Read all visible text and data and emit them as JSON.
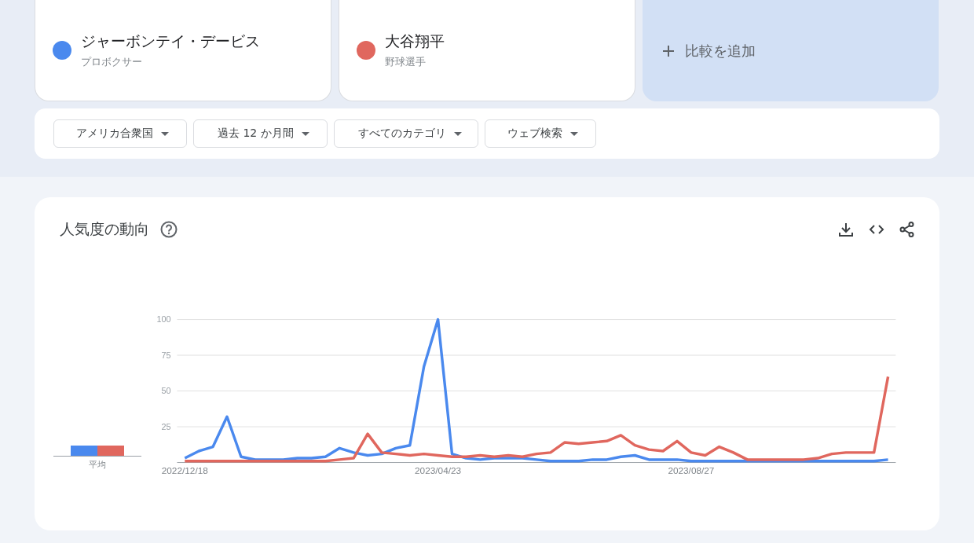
{
  "terms": [
    {
      "name": "ジャーボンテイ・デービス",
      "subtitle": "プロボクサー",
      "color": "#4a89ee"
    },
    {
      "name": "大谷翔平",
      "subtitle": "野球選手",
      "color": "#e0675e"
    }
  ],
  "add_compare": {
    "label": "比較を追加"
  },
  "filters": [
    "アメリカ合衆国",
    "過去 12 か月間",
    "すべてのカテゴリ",
    "ウェブ検索"
  ],
  "trend_card": {
    "title": "人気度の動向",
    "average_label": "平均",
    "chart_data": {
      "type": "line",
      "grid": true,
      "ylim": [
        0,
        100
      ],
      "yticks": [
        25,
        50,
        75,
        100
      ],
      "categories": [
        "2022/12/18",
        null,
        null,
        null,
        null,
        null,
        null,
        null,
        null,
        null,
        null,
        null,
        null,
        null,
        null,
        null,
        null,
        null,
        "2023/04/23",
        null,
        null,
        null,
        null,
        null,
        null,
        null,
        null,
        null,
        null,
        null,
        null,
        null,
        null,
        null,
        null,
        null,
        "2023/08/27",
        null,
        null,
        null,
        null,
        null,
        null,
        null,
        null,
        null,
        null,
        null,
        null,
        null,
        null
      ],
      "series": [
        {
          "color": "#4a89ee",
          "values": [
            3,
            8,
            11,
            32,
            4,
            2,
            2,
            2,
            3,
            3,
            4,
            10,
            7,
            5,
            6,
            10,
            12,
            67,
            100,
            6,
            3,
            2,
            3,
            3,
            3,
            2,
            1,
            1,
            1,
            2,
            2,
            4,
            5,
            2,
            2,
            2,
            1,
            1,
            1,
            1,
            1,
            1,
            1,
            1,
            1,
            1,
            1,
            1,
            1,
            1,
            2
          ]
        },
        {
          "color": "#e0675e",
          "values": [
            1,
            1,
            1,
            1,
            1,
            1,
            1,
            1,
            1,
            1,
            1,
            2,
            3,
            20,
            7,
            6,
            5,
            6,
            5,
            4,
            4,
            5,
            4,
            5,
            4,
            6,
            7,
            14,
            13,
            14,
            15,
            19,
            12,
            9,
            8,
            15,
            7,
            5,
            11,
            7,
            2,
            2,
            2,
            2,
            2,
            3,
            6,
            7,
            7,
            7,
            60
          ]
        }
      ]
    }
  }
}
